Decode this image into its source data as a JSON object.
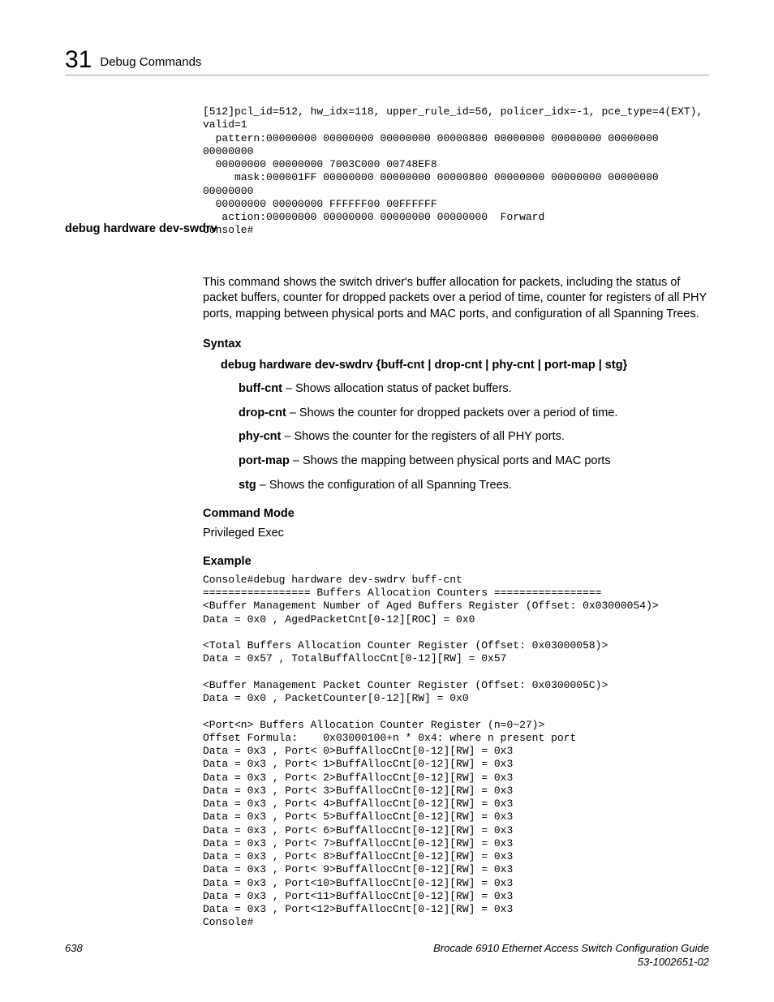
{
  "header": {
    "chapter_num": "31",
    "chapter_title": "Debug Commands"
  },
  "code1": "[512]pcl_id=512, hw_idx=118, upper_rule_id=56, policer_idx=-1, pce_type=4(EXT), valid=1\n  pattern:00000000 00000000 00000000 00000800 00000000 00000000 00000000 00000000 \n  00000000 00000000 7003C000 00748EF8\n     mask:000001FF 00000000 00000000 00000800 00000000 00000000 00000000 00000000 \n  00000000 00000000 FFFFFF00 00FFFFFF\n   action:00000000 00000000 00000000 00000000  Forward\nConsole#",
  "sidebar_heading": "debug hardware dev-swdrv",
  "description": "This command shows the switch driver's buffer allocation for packets, including the status of packet buffers, counter for dropped packets over a period of time, counter for registers of all PHY ports, mapping between physical ports and MAC ports, and configuration of all Spanning Trees.",
  "syntax": {
    "heading": "Syntax",
    "line": "debug hardware dev-swdrv {buff-cnt | drop-cnt | phy-cnt | port-map | stg}",
    "params": [
      {
        "name": "buff-cnt",
        "desc": " – Shows allocation status of packet buffers."
      },
      {
        "name": "drop-cnt",
        "desc": " – Shows the counter for dropped packets over a period of time."
      },
      {
        "name": "phy-cnt",
        "desc": " – Shows the counter for the registers of all PHY ports."
      },
      {
        "name": "port-map",
        "desc": " – Shows the mapping between physical ports and MAC ports"
      },
      {
        "name": "stg",
        "desc": " – Shows the configuration of all Spanning Trees."
      }
    ]
  },
  "command_mode": {
    "heading": "Command Mode",
    "value": "Privileged Exec"
  },
  "example": {
    "heading": "Example",
    "code": "Console#debug hardware dev-swdrv buff-cnt\n================= Buffers Allocation Counters =================\n<Buffer Management Number of Aged Buffers Register (Offset: 0x03000054)>\nData = 0x0 , AgedPacketCnt[0-12][ROC] = 0x0\n\n<Total Buffers Allocation Counter Register (Offset: 0x03000058)>\nData = 0x57 , TotalBuffAllocCnt[0-12][RW] = 0x57\n\n<Buffer Management Packet Counter Register (Offset: 0x0300005C)>\nData = 0x0 , PacketCounter[0-12][RW] = 0x0\n\n<Port<n> Buffers Allocation Counter Register (n=0~27)>\nOffset Formula:    0x03000100+n * 0x4: where n present port\nData = 0x3 , Port< 0>BuffAllocCnt[0-12][RW] = 0x3\nData = 0x3 , Port< 1>BuffAllocCnt[0-12][RW] = 0x3\nData = 0x3 , Port< 2>BuffAllocCnt[0-12][RW] = 0x3\nData = 0x3 , Port< 3>BuffAllocCnt[0-12][RW] = 0x3\nData = 0x3 , Port< 4>BuffAllocCnt[0-12][RW] = 0x3\nData = 0x3 , Port< 5>BuffAllocCnt[0-12][RW] = 0x3\nData = 0x3 , Port< 6>BuffAllocCnt[0-12][RW] = 0x3\nData = 0x3 , Port< 7>BuffAllocCnt[0-12][RW] = 0x3\nData = 0x3 , Port< 8>BuffAllocCnt[0-12][RW] = 0x3\nData = 0x3 , Port< 9>BuffAllocCnt[0-12][RW] = 0x3\nData = 0x3 , Port<10>BuffAllocCnt[0-12][RW] = 0x3\nData = 0x3 , Port<11>BuffAllocCnt[0-12][RW] = 0x3\nData = 0x3 , Port<12>BuffAllocCnt[0-12][RW] = 0x3\nConsole#"
  },
  "footer": {
    "page_num": "638",
    "guide_title": "Brocade 6910 Ethernet Access Switch Configuration Guide",
    "doc_num": "53-1002651-02"
  }
}
